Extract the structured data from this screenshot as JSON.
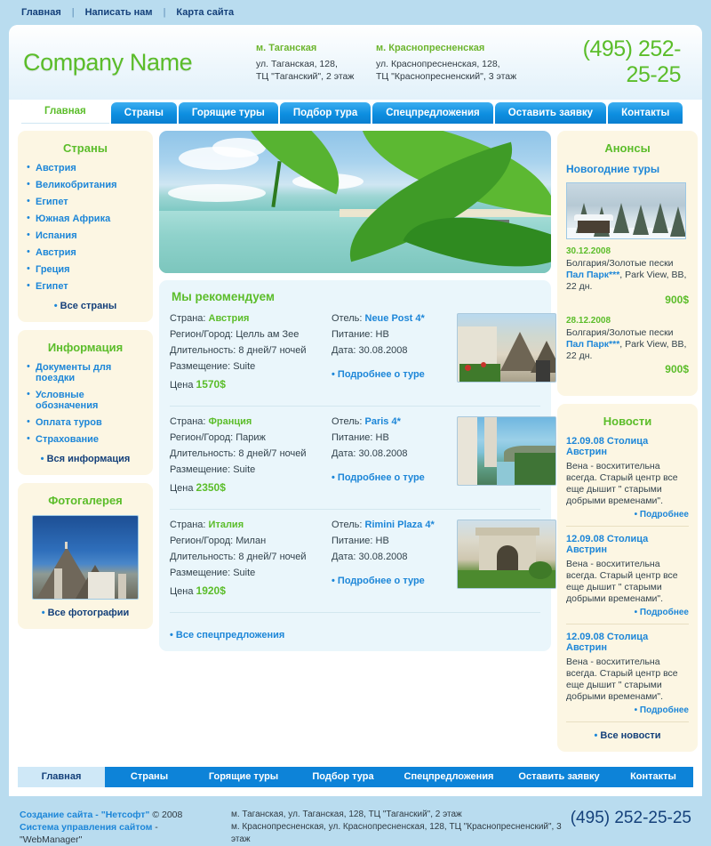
{
  "topnav": {
    "items": [
      {
        "label": "Главная"
      },
      {
        "label": "Написать нам"
      },
      {
        "label": "Карта сайта"
      }
    ],
    "separator": "|"
  },
  "header": {
    "logo": "Company Name",
    "phone": "(495) 252-25-25",
    "addresses": [
      {
        "metro": "м. Таганская",
        "line1": "ул. Таганская, 128,",
        "line2": "ТЦ \"Таганский\", 2 этаж"
      },
      {
        "metro": "м. Краснопресненская",
        "line1": "ул. Краснопресненская, 128,",
        "line2": "ТЦ \"Краснопресненский\", 3 этаж"
      }
    ]
  },
  "tabs": [
    {
      "label": "Главная",
      "active": true
    },
    {
      "label": "Страны",
      "active": false
    },
    {
      "label": "Горящие туры",
      "active": false
    },
    {
      "label": "Подбор тура",
      "active": false
    },
    {
      "label": "Спецпредложения",
      "active": false
    },
    {
      "label": "Оставить заявку",
      "active": false
    },
    {
      "label": "Контакты",
      "active": false
    }
  ],
  "sidebar_left": {
    "countries": {
      "title": "Страны",
      "items": [
        "Австрия",
        "Великобритания",
        "Египет",
        "Южная Африка",
        "Испания",
        "Австрия",
        "Греция",
        "Египет"
      ],
      "all_label": "Все страны"
    },
    "information": {
      "title": "Информация",
      "items": [
        "Документы для поездки",
        "Условные обозначения",
        "Оплата туров",
        "Страхование"
      ],
      "all_label": "Вся информация"
    },
    "gallery": {
      "title": "Фотогалерея",
      "all_label": "Все фотографии"
    }
  },
  "main": {
    "recommend_title": "Мы рекомендуем",
    "labels": {
      "country": "Страна:",
      "region": "Регион/Город:",
      "duration": "Длительность:",
      "accommodation": "Размещение:",
      "price": "Цена",
      "hotel": "Отель:",
      "meals": "Питание:",
      "date": "Дата:",
      "details": "Подробнее о туре"
    },
    "tours": [
      {
        "country": "Австрия",
        "region": "Целль ам Зее",
        "duration": "8 дней/7 ночей",
        "accommodation": "Suite",
        "price": "1570$",
        "hotel": "Neue Post 4*",
        "meals": "HB",
        "date": "30.08.2008"
      },
      {
        "country": "Франция",
        "region": "Париж",
        "duration": "8 дней/7 ночей",
        "accommodation": "Suite",
        "price": "2350$",
        "hotel": "Paris 4*",
        "meals": "HB",
        "date": "30.08.2008"
      },
      {
        "country": "Италия",
        "region": "Милан",
        "duration": "8 дней/7 ночей",
        "accommodation": "Suite",
        "price": "1920$",
        "hotel": "Rimini Plaza 4*",
        "meals": "HB",
        "date": "30.08.2008"
      }
    ],
    "all_specials_label": "Все спецпредложения"
  },
  "sidebar_right": {
    "announcements": {
      "title": "Анонсы",
      "subtitle": "Новогодние туры",
      "items": [
        {
          "date": "30.12.2008",
          "text_before": "Болгария/Золотые пески ",
          "link": "Пал Парк***",
          "text_after": ", Park View, BB, 22 дн.",
          "price": "900$"
        },
        {
          "date": "28.12.2008",
          "text_before": "Болгария/Золотые пески ",
          "link": "Пал Парк***",
          "text_after": ", Park View, BB, 22 дн.",
          "price": "900$"
        }
      ]
    },
    "news": {
      "title": "Новости",
      "items": [
        {
          "headline": "12.09.08 Столица Австрин",
          "body": "Вена - восхитительна всегда. Старый центр все еще дышит \" старыми добрыми временами\".",
          "more": "Подробнее"
        },
        {
          "headline": "12.09.08 Столица Австрин",
          "body": "Вена - восхитительна всегда. Старый центр все еще дышит \" старыми добрыми временами\".",
          "more": "Подробнее"
        },
        {
          "headline": "12.09.08 Столица Австрин",
          "body": "Вена - восхитительна всегда. Старый центр все еще дышит \" старыми добрыми временами\".",
          "more": "Подробнее"
        }
      ],
      "all_label": "Все новости"
    }
  },
  "footer_nav": [
    {
      "label": "Главная",
      "active": true
    },
    {
      "label": "Страны",
      "active": false
    },
    {
      "label": "Горящие туры",
      "active": false
    },
    {
      "label": "Подбор тура",
      "active": false
    },
    {
      "label": "Спецпредложения",
      "active": false
    },
    {
      "label": "Оставить заявку",
      "active": false
    },
    {
      "label": "Контакты",
      "active": false
    }
  ],
  "footer": {
    "credit1_link": "Создание сайта - \"Нетсофт\"",
    "credit1_rest": " © 2008",
    "credit2_link": "Система управления сайтом",
    "credit2_rest": " - \"WebManager\"",
    "address1": "м. Таганская, ул. Таганская, 128, ТЦ \"Таганский\", 2 этаж",
    "address2": "м. Краснопресненская, ул. Краснопресненская, 128, ТЦ \"Краснопресненский\", 3 этаж",
    "phone": "(495) 252-25-25"
  },
  "colors": {
    "page_bg": "#b9dcef",
    "accent_green": "#5bbd2a",
    "accent_blue": "#1c86d8",
    "tab_blue": "#0d83d8",
    "panel_beige": "#fcf6e3",
    "panel_lightblue": "#eaf6fb",
    "dark_blue_text": "#14407a"
  }
}
